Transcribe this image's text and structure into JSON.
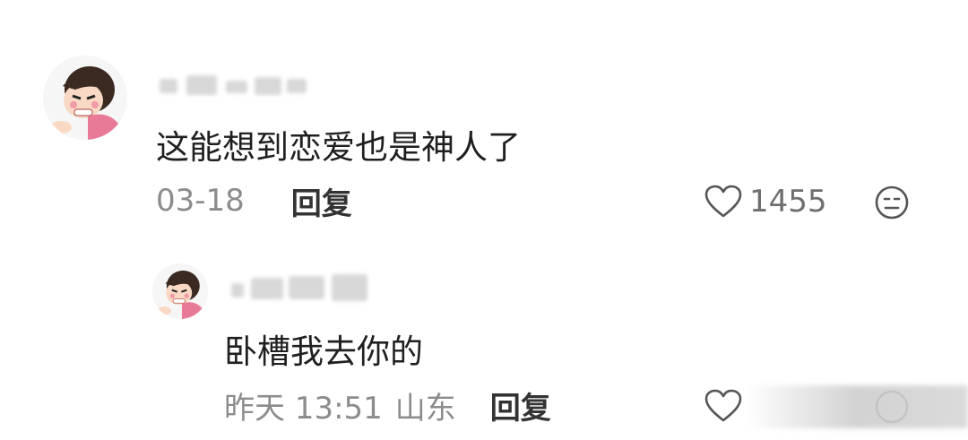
{
  "comments": [
    {
      "username": "",
      "text": "这能想到恋爱也是神人了",
      "date": "03-18",
      "location": "",
      "reply_label": "回复",
      "likes": "1455"
    },
    {
      "username": "",
      "text": "卧槽我去你的",
      "date": "昨天 13:51",
      "location": "山东",
      "reply_label": "回复",
      "likes": ""
    }
  ],
  "icons": {
    "like": "heart-icon",
    "dislike": "dislike-face-icon",
    "avatar": "avatar-icon"
  },
  "colors": {
    "text": "#1f1f1f",
    "meta": "#8c8c8c",
    "reply": "#333333",
    "avatar_pink": "#e87a98"
  }
}
